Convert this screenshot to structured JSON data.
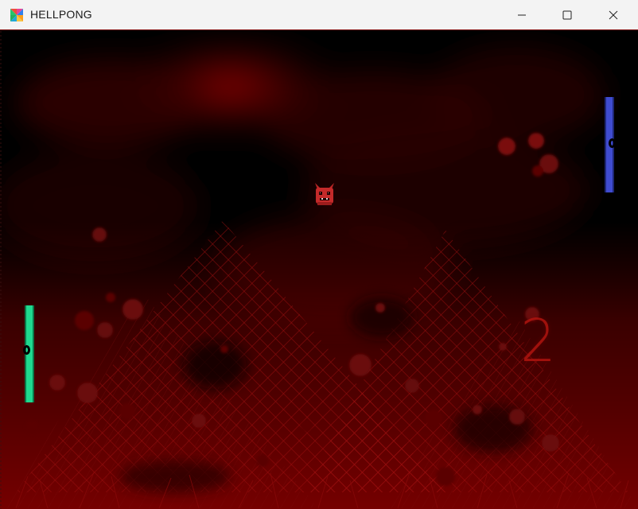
{
  "window": {
    "title": "HELLPONG",
    "controls": {
      "minimize_icon": "minimize-icon",
      "maximize_icon": "maximize-icon",
      "close_icon": "close-icon"
    }
  },
  "game": {
    "score_display": "2",
    "left_paddle": {
      "color": "#1fd98f"
    },
    "right_paddle": {
      "color": "#3f4cd0"
    },
    "ball": {
      "icon": "devil-face-icon",
      "color": "#c42a2a"
    },
    "background": {
      "base": "#000000",
      "accent": "#8b0000"
    }
  }
}
